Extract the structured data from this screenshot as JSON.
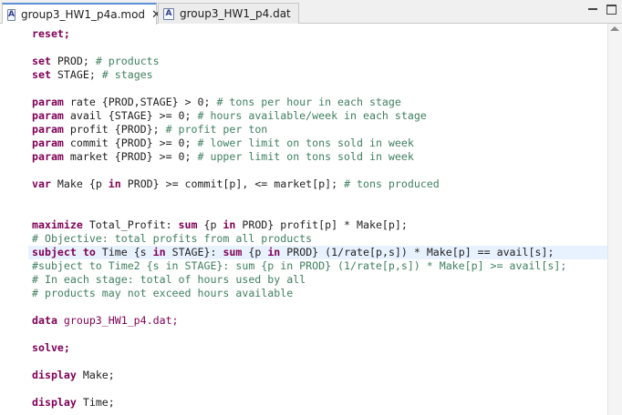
{
  "tabs": [
    {
      "icon_letter": "A",
      "label": "group3_HW1_p4a.mod",
      "close": "✕"
    },
    {
      "icon_letter": "A",
      "label": "group3_HW1_p4.dat"
    }
  ],
  "window_controls": {
    "minimize": "minimize-icon",
    "maximize": "maximize-icon"
  },
  "code": {
    "reset": "reset;",
    "set_prod": {
      "kw": "set",
      "body": " PROD; ",
      "comment": "# products"
    },
    "set_stage": {
      "kw": "set",
      "body": " STAGE; ",
      "comment": "# stages"
    },
    "param_rate": {
      "kw": "param",
      "body": " rate {PROD,STAGE} > 0; ",
      "comment": "# tons per hour in each stage"
    },
    "param_avail": {
      "kw": "param",
      "body": " avail {STAGE} >= 0; ",
      "comment": "# hours available/week in each stage"
    },
    "param_profit": {
      "kw": "param",
      "body": " profit {PROD}; ",
      "comment": "# profit per ton"
    },
    "param_commit": {
      "kw": "param",
      "body": " commit {PROD} >= 0; ",
      "comment": "# lower limit on tons sold in week"
    },
    "param_market": {
      "kw": "param",
      "body": " market {PROD} >= 0; ",
      "comment": "# upper limit on tons sold in week"
    },
    "var_make": {
      "kw": "var",
      "body1": " Make {p ",
      "in": "in",
      "body2": " PROD} >= commit[p], <= market[p]; ",
      "comment": "# tons produced"
    },
    "maximize": {
      "kw": "maximize",
      "body1": " Total_Profit: ",
      "sum": "sum",
      "body2": " {p ",
      "in": "in",
      "body3": " PROD} profit[p] * Make[p];"
    },
    "objective_comment": "# Objective: total profits from all products",
    "subject_to": {
      "kw": "subject to",
      "body1": " Time {s ",
      "in1": "in",
      "body2": " STAGE}: ",
      "sum": "sum",
      "body3": " {p ",
      "in2": "in",
      "body4": " PROD} (1/rate[p,s]) * Make[p] == avail[s];"
    },
    "subject_to_comment": "#subject to Time2 {s in STAGE}: sum {p in PROD} (1/rate[p,s]) * Make[p] >= avail[s];",
    "stage_comment": "# In each stage: total of hours used by all",
    "products_comment": "# products may not exceed hours available",
    "data_line": {
      "kw": "data",
      "body": " group3_HW1_p4.dat;"
    },
    "solve": "solve;",
    "display_make": {
      "kw": "display",
      "body": " Make;"
    },
    "display_time": {
      "kw": "display",
      "body": " Time;"
    }
  }
}
